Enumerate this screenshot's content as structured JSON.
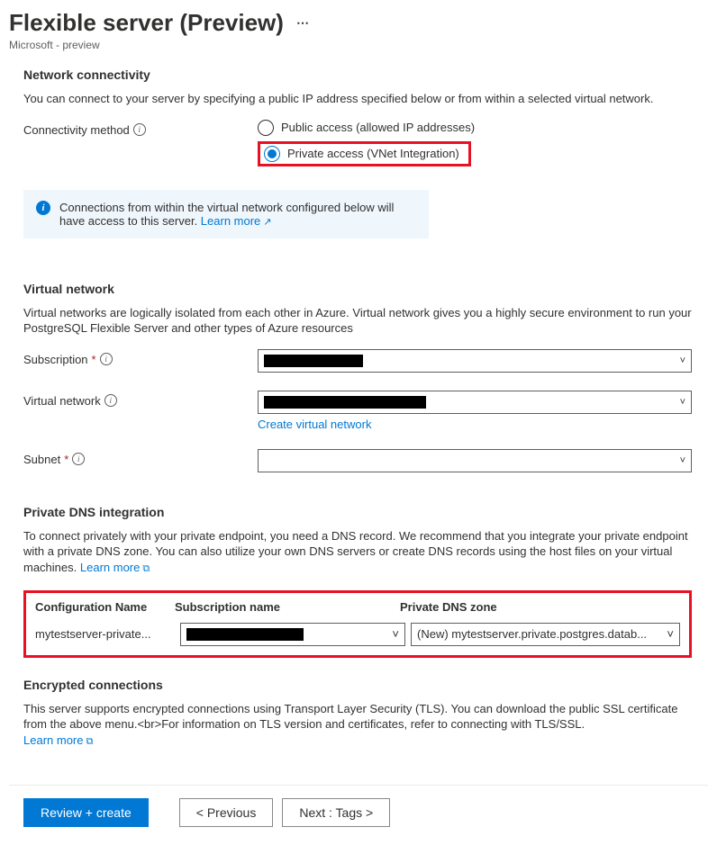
{
  "header": {
    "title": "Flexible server (Preview)",
    "subtitle": "Microsoft - preview"
  },
  "network": {
    "heading": "Network connectivity",
    "desc": "You can connect to your server by specifying a public IP address specified below or from within a selected virtual network.",
    "method_label": "Connectivity method",
    "opt_public": "Public access (allowed IP addresses)",
    "opt_private": "Private access (VNet Integration)"
  },
  "infobox": {
    "text": "Connections from within the virtual network configured below will have access to this server. ",
    "learn": "Learn more"
  },
  "vnet": {
    "heading": "Virtual network",
    "desc": "Virtual networks are logically isolated from each other in Azure. Virtual network gives you a highly secure environment to run your PostgreSQL Flexible Server and other types of Azure resources",
    "subscription_label": "Subscription",
    "vnet_label": "Virtual network",
    "create_link": "Create virtual network",
    "subnet_label": "Subnet"
  },
  "dns": {
    "heading": "Private DNS integration",
    "desc": "To connect privately with your private endpoint, you need a DNS record. We recommend that you integrate your private endpoint with a private DNS zone. You can also utilize your own DNS servers or create DNS records using the host files on your virtual machines. ",
    "learn": "Learn more",
    "col_config": "Configuration Name",
    "col_sub": "Subscription name",
    "col_zone": "Private DNS zone",
    "config_value": "mytestserver-private...",
    "zone_value": "(New) mytestserver.private.postgres.datab..."
  },
  "enc": {
    "heading": "Encrypted connections",
    "desc": "This server supports encrypted connections using Transport Layer Security (TLS). You can download the public SSL certificate from the above menu.<br>For information on TLS version and certificates, refer to connecting with TLS/SSL. ",
    "learn": "Learn more"
  },
  "footer": {
    "review": "Review + create",
    "prev": "< Previous",
    "next": "Next : Tags >"
  }
}
